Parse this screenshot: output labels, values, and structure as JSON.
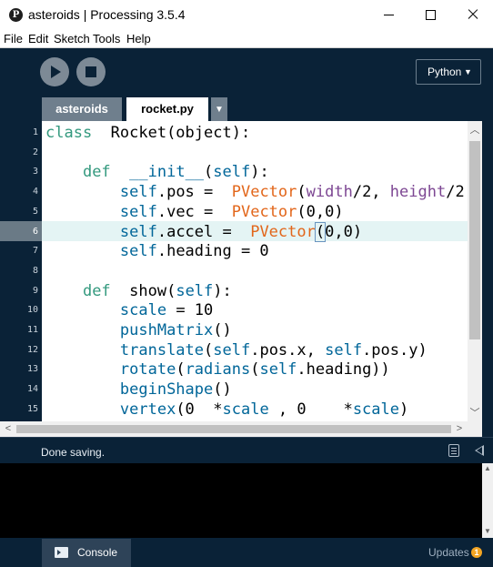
{
  "window": {
    "title": "asteroids | Processing 3.5.4",
    "app_icon": "processing-p-icon",
    "controls": [
      "minimize",
      "maximize",
      "close"
    ]
  },
  "menu": [
    "File",
    "Edit",
    "Sketch",
    "Tools",
    "Help"
  ],
  "toolbar": {
    "run_icon": "play-icon",
    "stop_icon": "stop-icon",
    "mode": "Python",
    "mode_arrow": "▼"
  },
  "tabs": [
    {
      "label": "asteroids",
      "active": false
    },
    {
      "label": "rocket.py",
      "active": true
    }
  ],
  "tab_menu_arrow": "▼",
  "editor": {
    "current_line": 6,
    "lines": [
      {
        "n": "1",
        "tokens": [
          [
            "kw",
            "class"
          ],
          [
            "",
            "  Rocket(object):"
          ]
        ]
      },
      {
        "n": "2",
        "tokens": []
      },
      {
        "n": "3",
        "tokens": [
          [
            "",
            "    "
          ],
          [
            "kw",
            "def"
          ],
          [
            "",
            "  "
          ],
          [
            "fn",
            "__init__"
          ],
          [
            "",
            "("
          ],
          [
            "self",
            "self"
          ],
          [
            "",
            "):"
          ]
        ]
      },
      {
        "n": "4",
        "tokens": [
          [
            "",
            "        "
          ],
          [
            "self",
            "self"
          ],
          [
            "",
            ".pos =  "
          ],
          [
            "cls",
            "PVector"
          ],
          [
            "",
            "("
          ],
          [
            "bl",
            "width"
          ],
          [
            "",
            "/2, "
          ],
          [
            "bl",
            "height"
          ],
          [
            "",
            "/2"
          ]
        ]
      },
      {
        "n": "5",
        "tokens": [
          [
            "",
            "        "
          ],
          [
            "self",
            "self"
          ],
          [
            "",
            ".vec =  "
          ],
          [
            "cls",
            "PVector"
          ],
          [
            "",
            "(0,0)"
          ]
        ]
      },
      {
        "n": "6",
        "tokens": [
          [
            "",
            "        "
          ],
          [
            "self",
            "self"
          ],
          [
            "",
            ".accel =  "
          ],
          [
            "cls",
            "PVector"
          ],
          [
            "br",
            "("
          ],
          [
            "",
            "0,0)"
          ]
        ]
      },
      {
        "n": "7",
        "tokens": [
          [
            "",
            "        "
          ],
          [
            "self",
            "self"
          ],
          [
            "",
            ".heading = 0"
          ]
        ]
      },
      {
        "n": "8",
        "tokens": []
      },
      {
        "n": "9",
        "tokens": [
          [
            "",
            "    "
          ],
          [
            "kw",
            "def"
          ],
          [
            "",
            "  show("
          ],
          [
            "self",
            "self"
          ],
          [
            "",
            "):"
          ]
        ]
      },
      {
        "n": "10",
        "tokens": [
          [
            "",
            "        "
          ],
          [
            "fn",
            "scale"
          ],
          [
            "",
            " = 10"
          ]
        ]
      },
      {
        "n": "11",
        "tokens": [
          [
            "",
            "        "
          ],
          [
            "fn",
            "pushMatrix"
          ],
          [
            "",
            "()"
          ]
        ]
      },
      {
        "n": "12",
        "tokens": [
          [
            "",
            "        "
          ],
          [
            "fn",
            "translate"
          ],
          [
            "",
            "("
          ],
          [
            "self",
            "self"
          ],
          [
            "",
            ".pos.x, "
          ],
          [
            "self",
            "self"
          ],
          [
            "",
            ".pos.y)"
          ]
        ]
      },
      {
        "n": "13",
        "tokens": [
          [
            "",
            "        "
          ],
          [
            "fn",
            "rotate"
          ],
          [
            "",
            "("
          ],
          [
            "fn",
            "radians"
          ],
          [
            "",
            "("
          ],
          [
            "self",
            "self"
          ],
          [
            "",
            ".heading))"
          ]
        ]
      },
      {
        "n": "14",
        "tokens": [
          [
            "",
            "        "
          ],
          [
            "fn",
            "beginShape"
          ],
          [
            "",
            "()"
          ]
        ]
      },
      {
        "n": "15",
        "tokens": [
          [
            "",
            "        "
          ],
          [
            "fn",
            "vertex"
          ],
          [
            "",
            "(0  *"
          ],
          [
            "fn",
            "scale"
          ],
          [
            "",
            " , 0    *"
          ],
          [
            "fn",
            "scale"
          ],
          [
            "",
            ")"
          ]
        ]
      }
    ]
  },
  "status": {
    "message": "Done saving."
  },
  "footer": {
    "console_label": "Console",
    "updates_label": "Updates",
    "updates_count": "1"
  },
  "colors": {
    "chrome": "#0a2237",
    "keyword": "#33997e",
    "function": "#006699",
    "class": "#e2661a",
    "builtin": "#7d4793",
    "current_line": "#e4f4f4",
    "badge": "#f3a523"
  }
}
